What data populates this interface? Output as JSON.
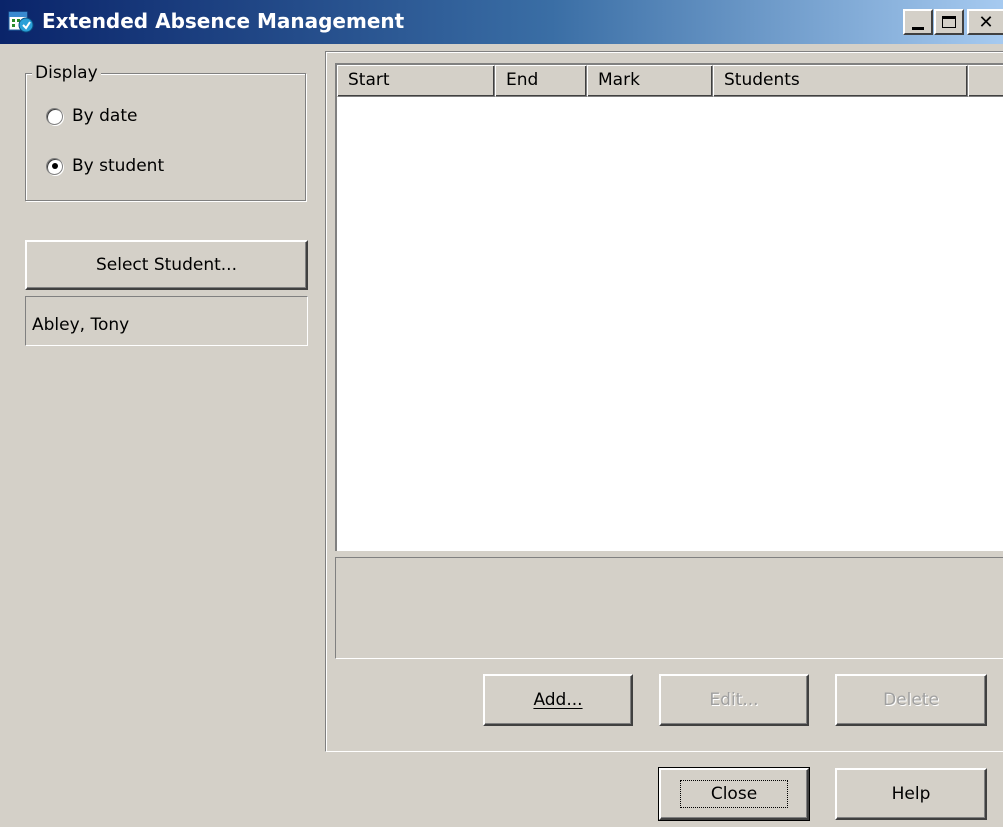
{
  "window": {
    "title": "Extended Absence Management",
    "icon": "calendar-app-icon",
    "controls": [
      "minimize",
      "maximize",
      "close"
    ]
  },
  "display_group": {
    "legend": "Display",
    "options": [
      {
        "label": "By date",
        "selected": false
      },
      {
        "label": "By student",
        "selected": true
      }
    ]
  },
  "select_student_label": "Select Student...",
  "selected_student": "Abley, Tony",
  "table": {
    "columns": [
      "Start",
      "End",
      "Mark",
      "Students",
      ""
    ],
    "rows": []
  },
  "actions": {
    "add": "Add...",
    "edit": "Edit...",
    "delete": "Delete"
  },
  "footer": {
    "close": "Close",
    "help": "Help"
  },
  "colors": {
    "face": "#d4d0c8",
    "title_start": "#0a246a",
    "title_end": "#a6caf0"
  }
}
